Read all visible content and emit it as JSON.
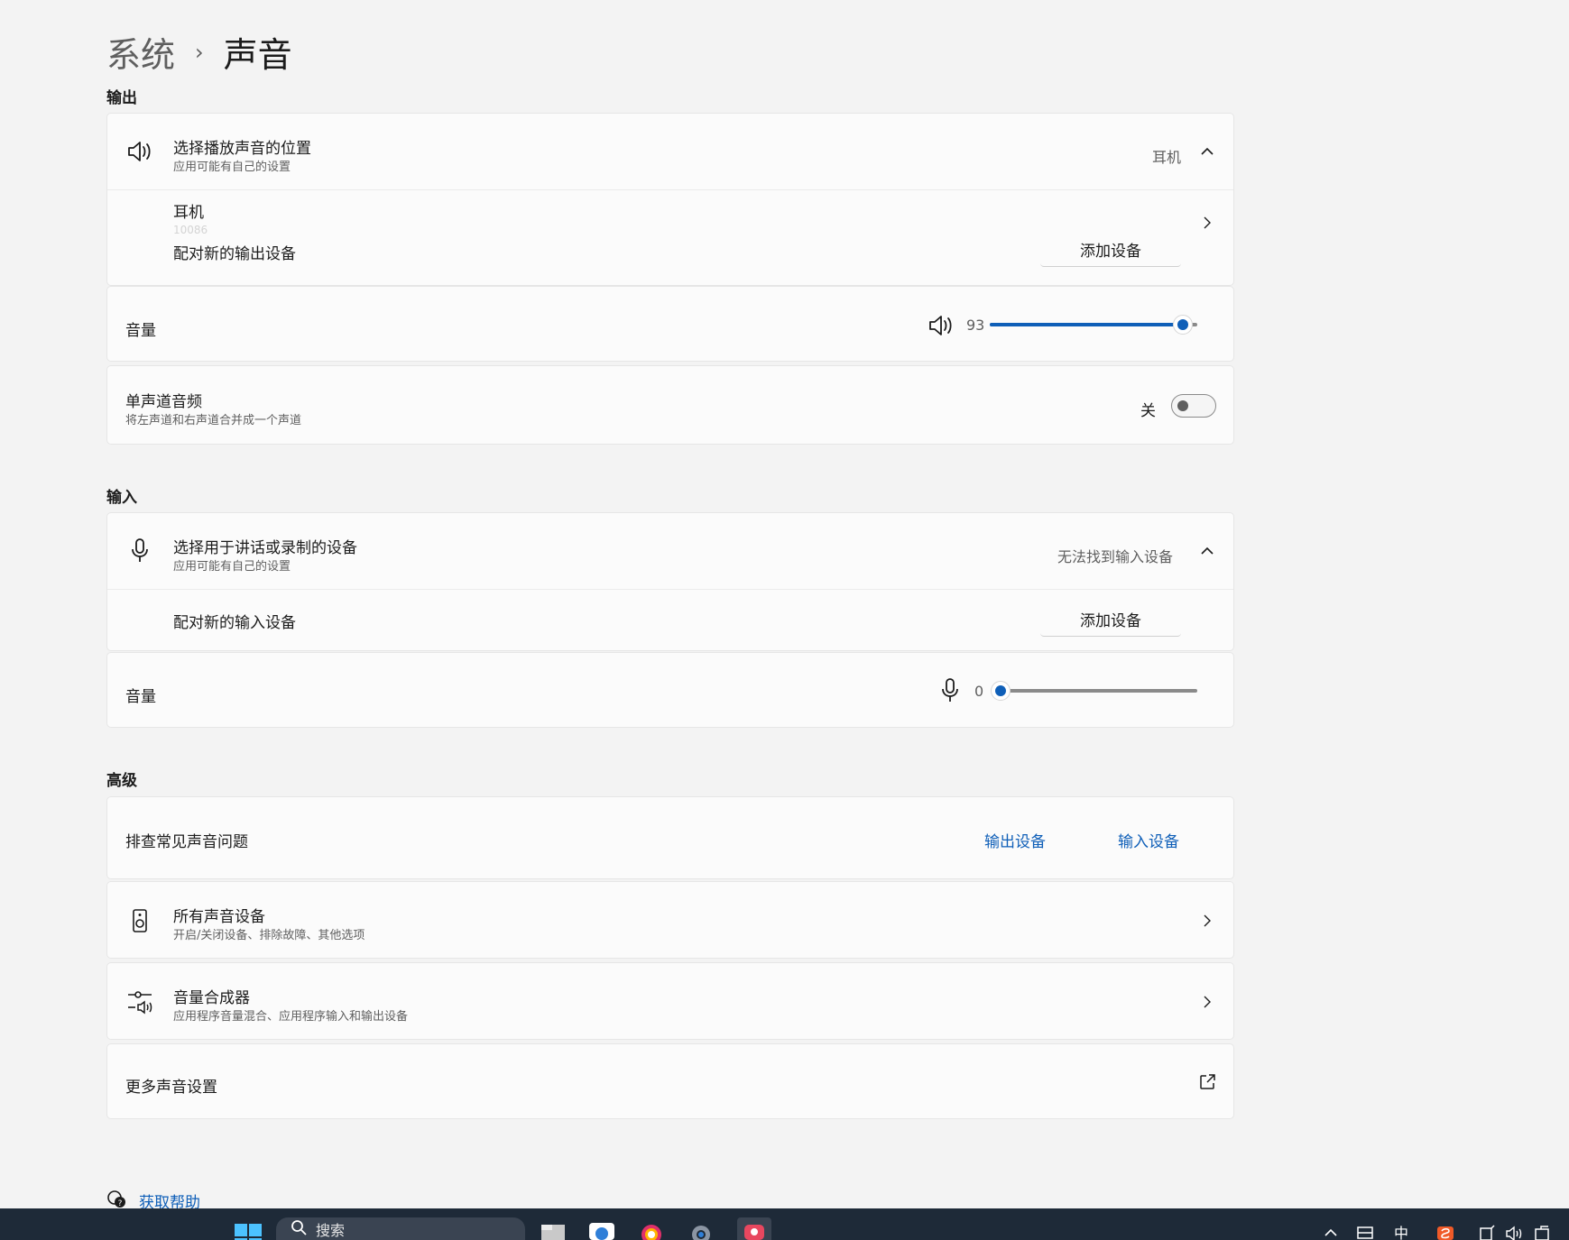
{
  "breadcrumb": {
    "parent": "系统",
    "separator": "›",
    "current": "声音"
  },
  "output": {
    "section_title": "输出",
    "device_picker": {
      "title": "选择播放声音的位置",
      "subtitle": "应用可能有自己的设置",
      "value": "耳机"
    },
    "device_item": {
      "name": "耳机",
      "detail": "10086"
    },
    "pair": {
      "label": "配对新的输出设备",
      "button": "添加设备"
    },
    "volume": {
      "label": "音量",
      "value": "93",
      "level_percent": 93
    },
    "mono": {
      "title": "单声道音频",
      "subtitle": "将左声道和右声道合并成一个声道",
      "state_label": "关"
    }
  },
  "input": {
    "section_title": "输入",
    "device_picker": {
      "title": "选择用于讲话或录制的设备",
      "subtitle": "应用可能有自己的设置",
      "value": "无法找到输入设备"
    },
    "pair": {
      "label": "配对新的输入设备",
      "button": "添加设备"
    },
    "volume": {
      "label": "音量",
      "value": "0",
      "level_percent": 0
    }
  },
  "advanced": {
    "section_title": "高级",
    "troubleshoot": {
      "label": "排查常见声音问题",
      "output_link": "输出设备",
      "input_link": "输入设备"
    },
    "all_devices": {
      "title": "所有声音设备",
      "subtitle": "开启/关闭设备、排除故障、其他选项"
    },
    "mixer": {
      "title": "音量合成器",
      "subtitle": "应用程序音量混合、应用程序输入和输出设备"
    },
    "more": {
      "label": "更多声音设置"
    }
  },
  "help": {
    "label": "获取帮助"
  },
  "taskbar": {
    "search_label": "搜索",
    "ime_label": "中"
  },
  "colors": {
    "accent": "#0f5fb8",
    "background": "#f3f3f3",
    "card": "#fbfbfb",
    "taskbar": "#1e2a38"
  }
}
